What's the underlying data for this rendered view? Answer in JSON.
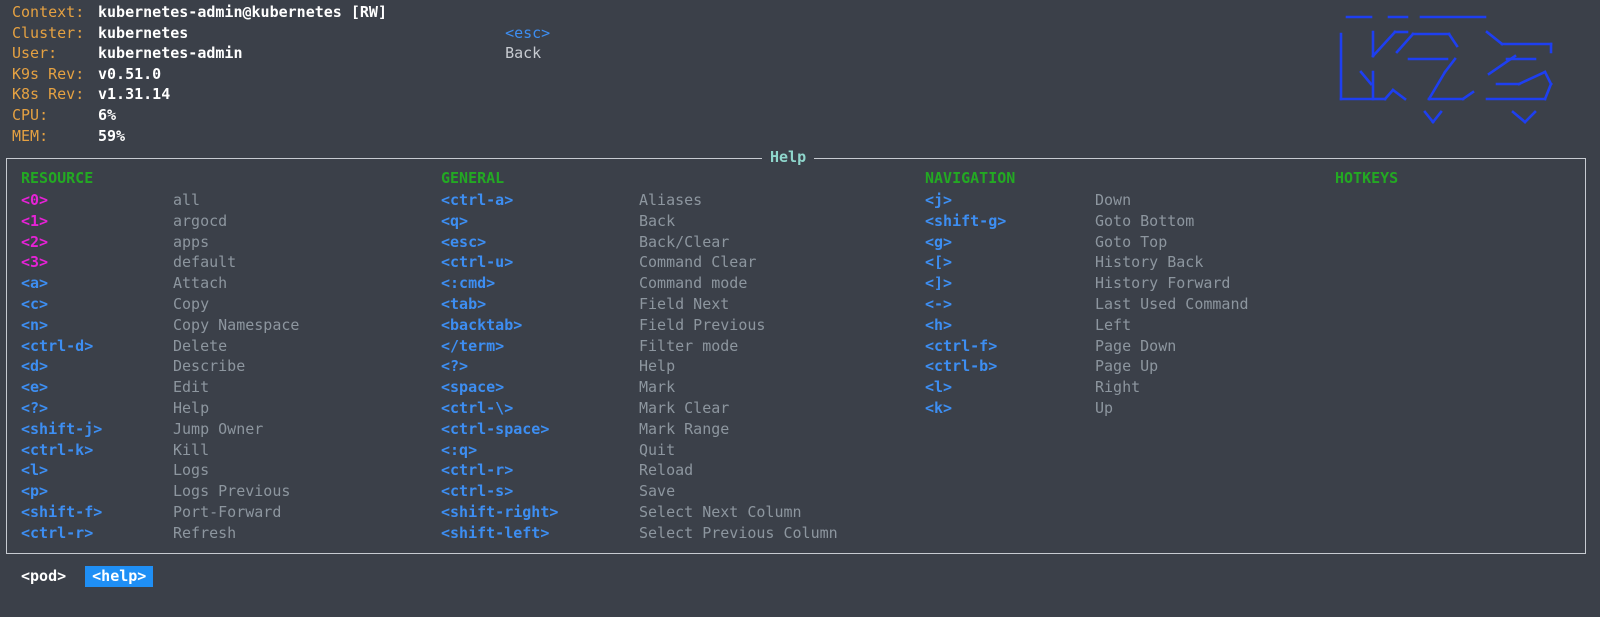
{
  "header": {
    "rows": [
      {
        "label": "Context:",
        "value": "kubernetes-admin@kubernetes [RW]"
      },
      {
        "label": "Cluster:",
        "value": "kubernetes"
      },
      {
        "label": "User:",
        "value": "kubernetes-admin"
      },
      {
        "label": "K9s Rev:",
        "value": "v0.51.0"
      },
      {
        "label": "K8s Rev:",
        "value": "v1.31.14"
      },
      {
        "label": "CPU:",
        "value": "6%"
      },
      {
        "label": "MEM:",
        "value": "59%"
      }
    ],
    "menu": {
      "key": "<esc>",
      "label": "Back"
    }
  },
  "help": {
    "title": "Help",
    "sections": {
      "resource": "RESOURCE",
      "general": "GENERAL",
      "navigation": "NAVIGATION",
      "hotkeys": "HOTKEYS"
    },
    "resource": [
      {
        "key": "<0>",
        "desc": "all",
        "color": "pink"
      },
      {
        "key": "<1>",
        "desc": "argocd",
        "color": "pink"
      },
      {
        "key": "<2>",
        "desc": "apps",
        "color": "pink"
      },
      {
        "key": "<3>",
        "desc": "default",
        "color": "pink"
      },
      {
        "key": "<a>",
        "desc": "Attach",
        "color": "blue"
      },
      {
        "key": "<c>",
        "desc": "Copy",
        "color": "blue"
      },
      {
        "key": "<n>",
        "desc": "Copy Namespace",
        "color": "blue"
      },
      {
        "key": "<ctrl-d>",
        "desc": "Delete",
        "color": "blue"
      },
      {
        "key": "<d>",
        "desc": "Describe",
        "color": "blue"
      },
      {
        "key": "<e>",
        "desc": "Edit",
        "color": "blue"
      },
      {
        "key": "<?>",
        "desc": "Help",
        "color": "blue"
      },
      {
        "key": "<shift-j>",
        "desc": "Jump Owner",
        "color": "blue"
      },
      {
        "key": "<ctrl-k>",
        "desc": "Kill",
        "color": "blue"
      },
      {
        "key": "<l>",
        "desc": "Logs",
        "color": "blue"
      },
      {
        "key": "<p>",
        "desc": "Logs Previous",
        "color": "blue"
      },
      {
        "key": "<shift-f>",
        "desc": "Port-Forward",
        "color": "blue"
      },
      {
        "key": "<ctrl-r>",
        "desc": "Refresh",
        "color": "blue"
      }
    ],
    "general": [
      {
        "key": "<ctrl-a>",
        "desc": "Aliases"
      },
      {
        "key": "<q>",
        "desc": "Back"
      },
      {
        "key": "<esc>",
        "desc": "Back/Clear"
      },
      {
        "key": "<ctrl-u>",
        "desc": "Command Clear"
      },
      {
        "key": "<:cmd>",
        "desc": "Command mode"
      },
      {
        "key": "<tab>",
        "desc": "Field Next"
      },
      {
        "key": "<backtab>",
        "desc": "Field Previous"
      },
      {
        "key": "</term>",
        "desc": "Filter mode"
      },
      {
        "key": "<?>",
        "desc": "Help"
      },
      {
        "key": "<space>",
        "desc": "Mark"
      },
      {
        "key": "<ctrl-\\>",
        "desc": "Mark Clear"
      },
      {
        "key": "<ctrl-space>",
        "desc": "Mark Range"
      },
      {
        "key": "<:q>",
        "desc": "Quit"
      },
      {
        "key": "<ctrl-r>",
        "desc": "Reload"
      },
      {
        "key": "<ctrl-s>",
        "desc": "Save"
      },
      {
        "key": "<shift-right>",
        "desc": "Select Next Column"
      },
      {
        "key": "<shift-left>",
        "desc": "Select Previous Column"
      }
    ],
    "navigation": [
      {
        "key": "<j>",
        "desc": "Down"
      },
      {
        "key": "<shift-g>",
        "desc": "Goto Bottom"
      },
      {
        "key": "<g>",
        "desc": "Goto Top"
      },
      {
        "key": "<[>",
        "desc": "History Back"
      },
      {
        "key": "<]>",
        "desc": "History Forward"
      },
      {
        "key": "<->",
        "desc": "Last Used Command"
      },
      {
        "key": "<h>",
        "desc": "Left"
      },
      {
        "key": "<ctrl-f>",
        "desc": "Page Down"
      },
      {
        "key": "<ctrl-b>",
        "desc": "Page Up"
      },
      {
        "key": "<l>",
        "desc": "Right"
      },
      {
        "key": "<k>",
        "desc": "Up"
      }
    ]
  },
  "breadcrumbs": [
    {
      "label": "<pod>",
      "active": false
    },
    {
      "label": "<help>",
      "active": true
    }
  ],
  "colors": {
    "background": "#3b4049",
    "label_orange": "#e5a142",
    "key_blue": "#3d8ef2",
    "key_pink": "#e622d6",
    "section_green": "#23a923",
    "title_cyan": "#8fd6cc",
    "crumb_active": "#1f8ff5",
    "logo_blue": "#1e3ff0"
  },
  "logo": {
    "icon": "k9s-ascii-logo"
  }
}
